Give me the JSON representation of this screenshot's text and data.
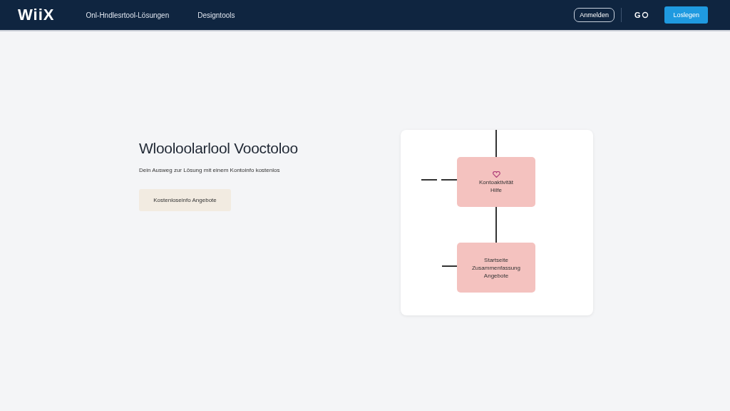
{
  "navbar": {
    "logo": "WiiX",
    "links": [
      "Onl-Hndlesrtool-Lösungen",
      "Designtools"
    ],
    "login_button": "Anmelden",
    "icon_text": "G",
    "cta_button": "Loslegen"
  },
  "hero": {
    "heading": "Wlooloolarlool Vooctoloo",
    "subtitle": "Dein Ausweg zur Lösung mit einem Kontoinfo kostenlos",
    "button": "Kostenloseinfo Angebote"
  },
  "diagram": {
    "boxes": [
      {
        "kind": "icon",
        "lines": [
          "Kontoaktivität",
          "Hilfe"
        ]
      },
      {
        "kind": "plain",
        "lines": [
          "Startseite",
          "Zusammenfassung",
          "Angebote"
        ]
      }
    ]
  }
}
